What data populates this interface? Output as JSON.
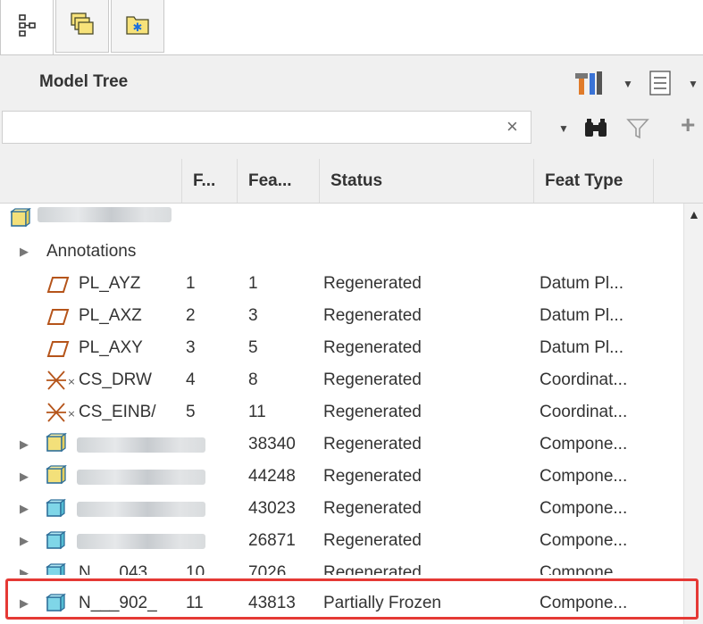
{
  "tabs": [
    {
      "name": "model-tree-tab",
      "icon": "tree-icon",
      "active": true
    },
    {
      "name": "folder-browser-tab",
      "icon": "folders-icon",
      "active": false
    },
    {
      "name": "favorites-tab",
      "icon": "star-folder-icon",
      "active": false
    }
  ],
  "panel": {
    "title": "Model Tree",
    "settings_icon": "tools-icon",
    "show_icon": "list-icon"
  },
  "search": {
    "value": "",
    "placeholder": "",
    "clear_label": "×",
    "find_icon": "binoculars-icon",
    "filter_icon": "filter-icon",
    "add_label": "+"
  },
  "columns": [
    "F...",
    "Fea...",
    "Status",
    "Feat Type"
  ],
  "tree": {
    "annotations_label": "Annotations",
    "rows": [
      {
        "name": "PL_AYZ",
        "f": "1",
        "fea": "1",
        "status": "Regenerated",
        "type": "Datum Pl...",
        "icon": "datum-plane-icon"
      },
      {
        "name": "PL_AXZ",
        "f": "2",
        "fea": "3",
        "status": "Regenerated",
        "type": "Datum Pl...",
        "icon": "datum-plane-icon"
      },
      {
        "name": "PL_AXY",
        "f": "3",
        "fea": "5",
        "status": "Regenerated",
        "type": "Datum Pl...",
        "icon": "datum-plane-icon"
      },
      {
        "name": "CS_DRW",
        "f": "4",
        "fea": "8",
        "status": "Regenerated",
        "type": "Coordinat...",
        "icon": "coordinate-system-icon"
      },
      {
        "name": "CS_EINB/",
        "f": "5",
        "fea": "11",
        "status": "Regenerated",
        "type": "Coordinat...",
        "icon": "coordinate-system-icon"
      },
      {
        "name": "",
        "f": "",
        "fea": "38340",
        "status": "Regenerated",
        "type": "Compone...",
        "icon": "assembly-icon"
      },
      {
        "name": "",
        "f": "",
        "fea": "44248",
        "status": "Regenerated",
        "type": "Compone...",
        "icon": "assembly-icon"
      },
      {
        "name": "",
        "f": "",
        "fea": "43023",
        "status": "Regenerated",
        "type": "Compone...",
        "icon": "part-icon"
      },
      {
        "name": "",
        "f": "",
        "fea": "26871",
        "status": "Regenerated",
        "type": "Compone...",
        "icon": "part-icon"
      },
      {
        "name": "N___043_",
        "f": "10",
        "fea": "7026",
        "status": "Regenerated",
        "type": "Compone...",
        "icon": "part-icon"
      },
      {
        "name": "N___902_",
        "f": "11",
        "fea": "43813",
        "status": "Partially Frozen",
        "type": "Compone...",
        "icon": "part-icon"
      }
    ]
  },
  "colors": {
    "highlight": "#e53935",
    "assembly": "#f3e07a",
    "part": "#7fd6e8",
    "datum": "#b5541a"
  }
}
